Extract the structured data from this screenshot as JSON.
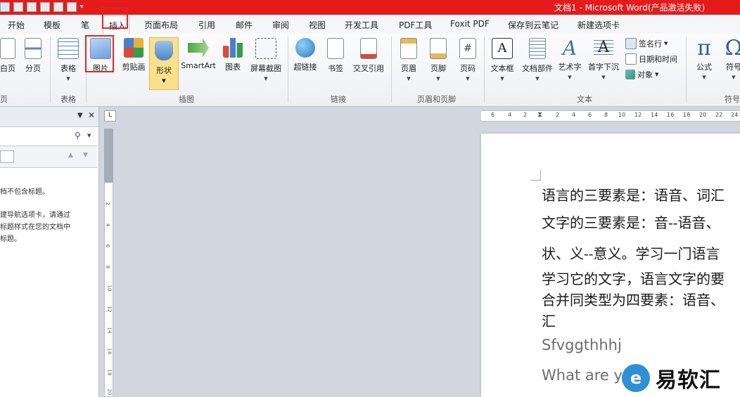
{
  "window": {
    "title": "文档1 - Microsoft Word(产品激活失败)"
  },
  "tabs": [
    {
      "label": "开始"
    },
    {
      "label": "模板"
    },
    {
      "label": "笔"
    },
    {
      "label": "插入"
    },
    {
      "label": "页面布局"
    },
    {
      "label": "引用"
    },
    {
      "label": "邮件"
    },
    {
      "label": "审阅"
    },
    {
      "label": "视图"
    },
    {
      "label": "开发工具"
    },
    {
      "label": "PDF工具"
    },
    {
      "label": "Foxit PDF"
    },
    {
      "label": "保存到云笔记"
    },
    {
      "label": "新建选项卡"
    }
  ],
  "active_tab": "插入",
  "ribbon": {
    "buttons": {
      "blank_page": "白页",
      "page_break": "分页",
      "table": "表格",
      "picture": "图片",
      "clipart": "剪贴画",
      "shapes": "形状",
      "smartart": "SmartArt",
      "chart": "图表",
      "screenshot": "屏幕截图",
      "hyperlink": "超链接",
      "bookmark": "书签",
      "crossref": "交叉引用",
      "header": "页眉",
      "footer": "页脚",
      "page_number": "页码",
      "textbox": "文本框",
      "quickparts": "文档部件",
      "wordart": "艺术字",
      "dropcap": "首字下沉",
      "signature": "签名行",
      "datetime": "日期和时间",
      "object": "对象",
      "equation": "公式",
      "symbol": "符号"
    },
    "groups": {
      "pages": "页",
      "tables": "表格",
      "illustrations": "插图",
      "links": "链接",
      "header_footer": "页眉和页脚",
      "text": "文本",
      "symbols": "符号"
    }
  },
  "navpane": {
    "line1": "档不包含标题。",
    "line2": "建导航选项卡，请通过",
    "line3": "标题样式在您的文档中",
    "line4": "标题。"
  },
  "ruler": {
    "h_ticks": [
      "6",
      "4",
      "2",
      "2",
      "4",
      "6",
      "8",
      "10",
      "12",
      "14",
      "16",
      "18",
      "20",
      "22",
      "24"
    ],
    "v_ticks": [
      "4",
      "2",
      "2",
      "4",
      "6",
      "8",
      "10",
      "12",
      "14",
      "16",
      "18",
      "20"
    ]
  },
  "document": {
    "lines": [
      "语言的三要素是：语音、词汇",
      "文字的三要素是：音--语音、",
      "状、义--意义。学习一门语言",
      "学习它的文字，语言文字的要",
      "合并同类型为四要素：语音、",
      "汇",
      "Sfvggthhhj",
      "What are y"
    ]
  },
  "watermark": {
    "logo_char": "e",
    "text": "易软汇"
  },
  "colors": {
    "titlebar": "#e51b1b",
    "highlight_box": "#e0252a",
    "shape_selected": "#fbe08a"
  }
}
